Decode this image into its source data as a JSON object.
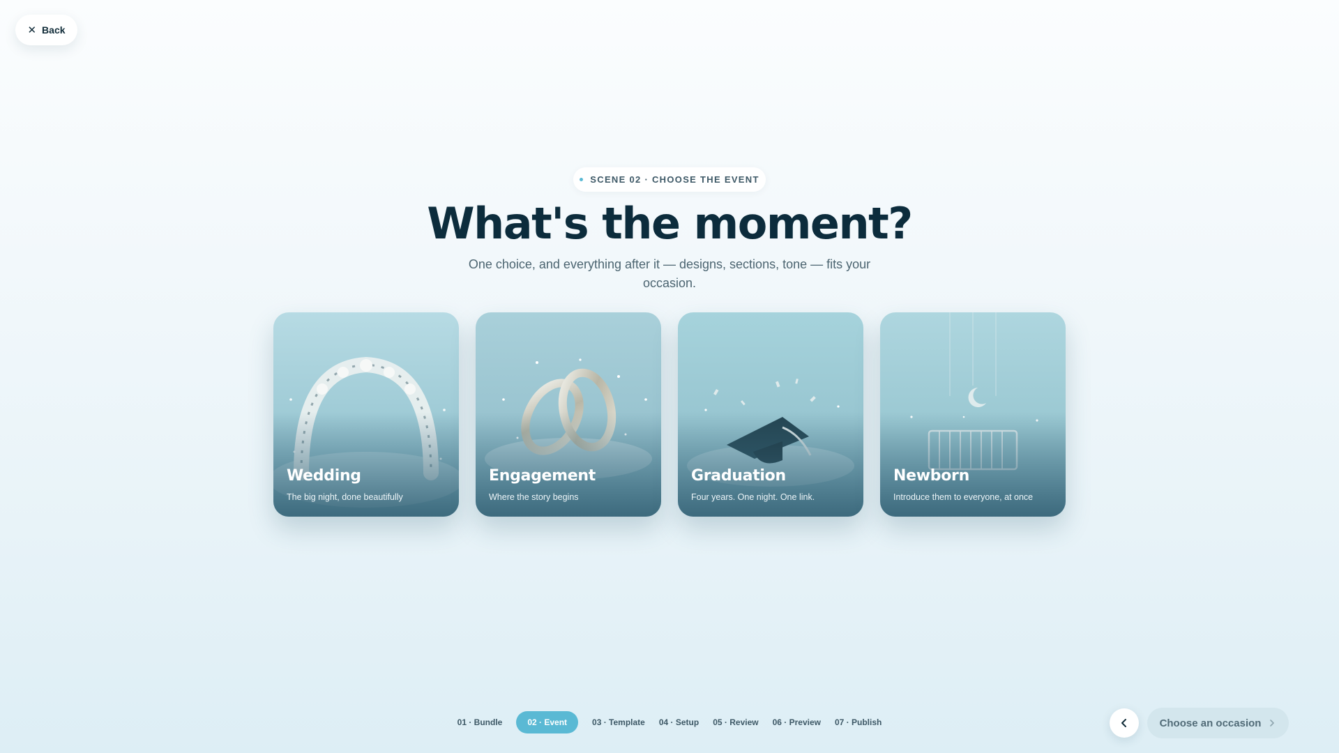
{
  "header": {
    "back_label": "Back",
    "back_icon": "close-icon"
  },
  "hero": {
    "eyebrow": "SCENE 02 · CHOOSE THE EVENT",
    "title": "What's the moment?",
    "subtitle": "One choice, and everything after it — designs, sections, tone — fits your occasion."
  },
  "events": [
    {
      "title": "Wedding",
      "description": "The big night, done beautifully",
      "icon": "floral-arch-icon"
    },
    {
      "title": "Engagement",
      "description": "Where the story begins",
      "icon": "rings-icon"
    },
    {
      "title": "Graduation",
      "description": "Four years. One night. One link.",
      "icon": "graduation-cap-icon"
    },
    {
      "title": "Newborn",
      "description": "Introduce them to everyone, at once",
      "icon": "crib-icon"
    }
  ],
  "steps": [
    {
      "label": "01 · Bundle",
      "active": false
    },
    {
      "label": "02 · Event",
      "active": true
    },
    {
      "label": "03 · Template",
      "active": false
    },
    {
      "label": "04 · Setup",
      "active": false
    },
    {
      "label": "05 · Review",
      "active": false
    },
    {
      "label": "06 · Preview",
      "active": false
    },
    {
      "label": "07 · Publish",
      "active": false
    }
  ],
  "footer": {
    "prev_icon": "chevron-left-icon",
    "next_label": "Choose an occasion",
    "next_icon": "chevron-right-icon"
  },
  "colors": {
    "accent": "#5ab9d4",
    "heading": "#0c2c3c",
    "next_button_bg": "#d3e6ed"
  }
}
